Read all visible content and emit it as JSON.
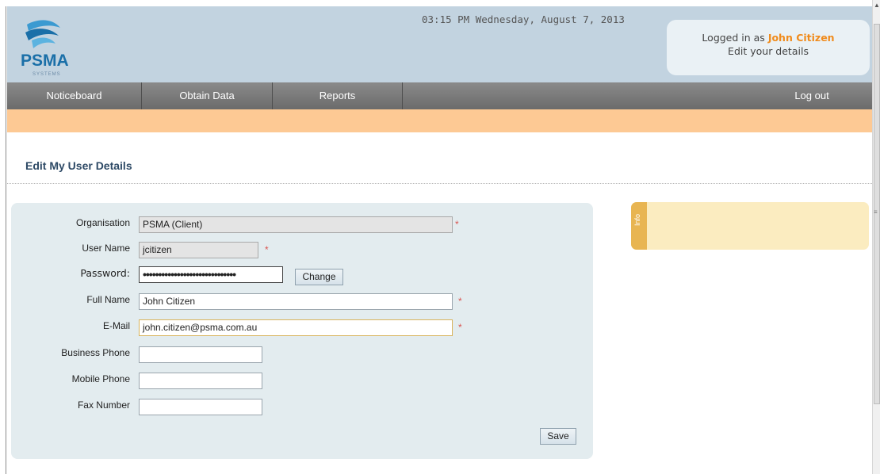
{
  "header": {
    "logo_text": "PSMA",
    "logo_subtext": "SYSTEMS",
    "datetime": "03:15 PM Wednesday, August 7, 2013",
    "logged_in_prefix": "Logged in as",
    "user_name": "John Citizen",
    "edit_details_link": "Edit your details"
  },
  "nav": {
    "items": [
      {
        "label": "Noticeboard"
      },
      {
        "label": "Obtain Data"
      },
      {
        "label": "Reports"
      }
    ],
    "logout_label": "Log out"
  },
  "page": {
    "title": "Edit My User Details"
  },
  "form": {
    "organisation": {
      "label": "Organisation",
      "value": "PSMA (Client)",
      "readonly": true,
      "required": true
    },
    "user_name": {
      "label": "User Name",
      "value": "jcitizen",
      "readonly": true,
      "required": true
    },
    "password": {
      "label": "Password:",
      "masked_value": "••••••••••••••••••••••••••••••",
      "change_button": "Change"
    },
    "full_name": {
      "label": "Full Name",
      "value": "John Citizen",
      "required": true
    },
    "email": {
      "label": "E-Mail",
      "value": "john.citizen@psma.com.au",
      "required": true,
      "focused": true
    },
    "business_phone": {
      "label": "Business Phone",
      "value": ""
    },
    "mobile_phone": {
      "label": "Mobile Phone",
      "value": ""
    },
    "fax_number": {
      "label": "Fax Number",
      "value": ""
    },
    "required_marker": "*",
    "save_button": "Save"
  },
  "info_panel": {
    "tab_label": "Info"
  },
  "colors": {
    "header_bg": "#c2d3e0",
    "nav_bg": "#7a7a7a",
    "accent_orange": "#fdc994",
    "username_orange": "#f08b1c",
    "panel_bg": "#e3ecef",
    "info_bg": "#fbecc0",
    "required_red": "#d9534f"
  }
}
